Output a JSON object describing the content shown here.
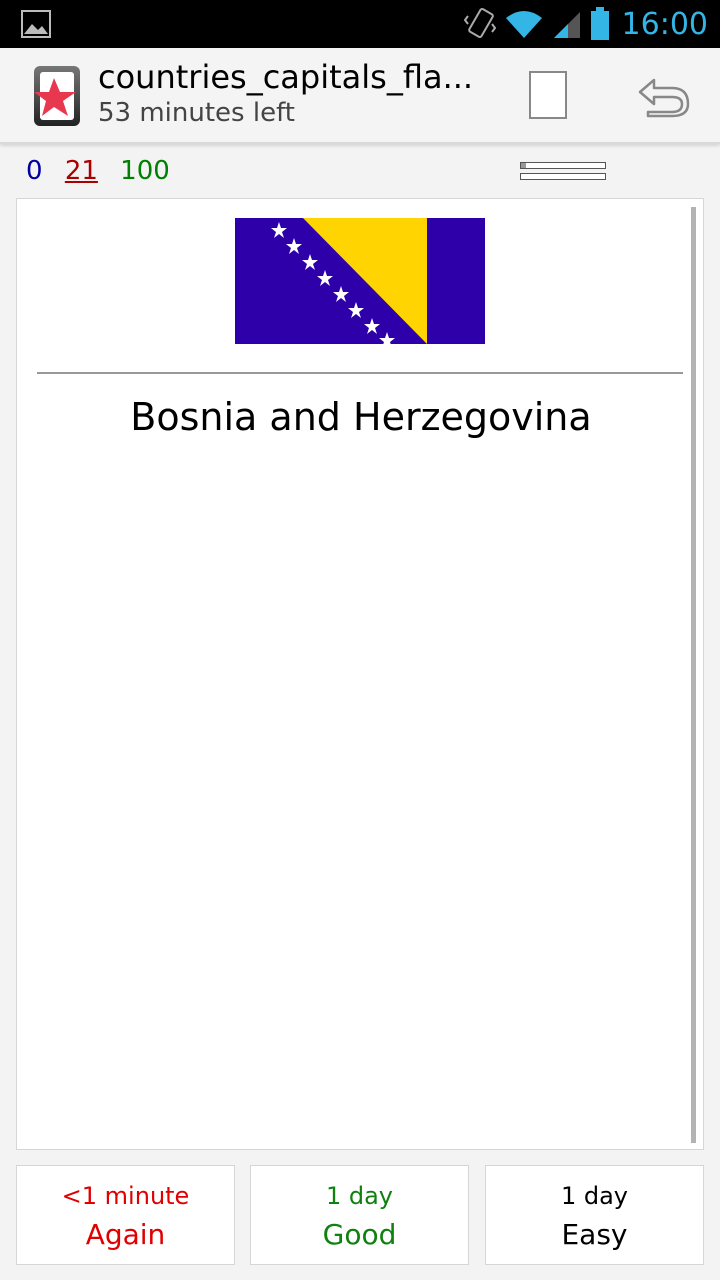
{
  "status_bar": {
    "time": "16:00",
    "icons": [
      "image-notification-icon",
      "vibrate-icon",
      "wifi-icon",
      "signal-icon",
      "battery-icon"
    ]
  },
  "action_bar": {
    "title": "countries_capitals_fla...",
    "subtitle": "53 minutes left"
  },
  "counts": {
    "new": "0",
    "learning": "21",
    "review": "100"
  },
  "card": {
    "answer": "Bosnia and Herzegovina"
  },
  "buttons": {
    "again": {
      "interval": "<1 minute",
      "label": "Again"
    },
    "good": {
      "interval": "1 day",
      "label": "Good"
    },
    "easy": {
      "interval": "1 day",
      "label": "Easy"
    }
  },
  "colors": {
    "accent": "#33b5e5",
    "again": "#e00000",
    "good": "#108010",
    "flag_blue": "#2d00aa",
    "flag_yellow": "#ffd400"
  }
}
